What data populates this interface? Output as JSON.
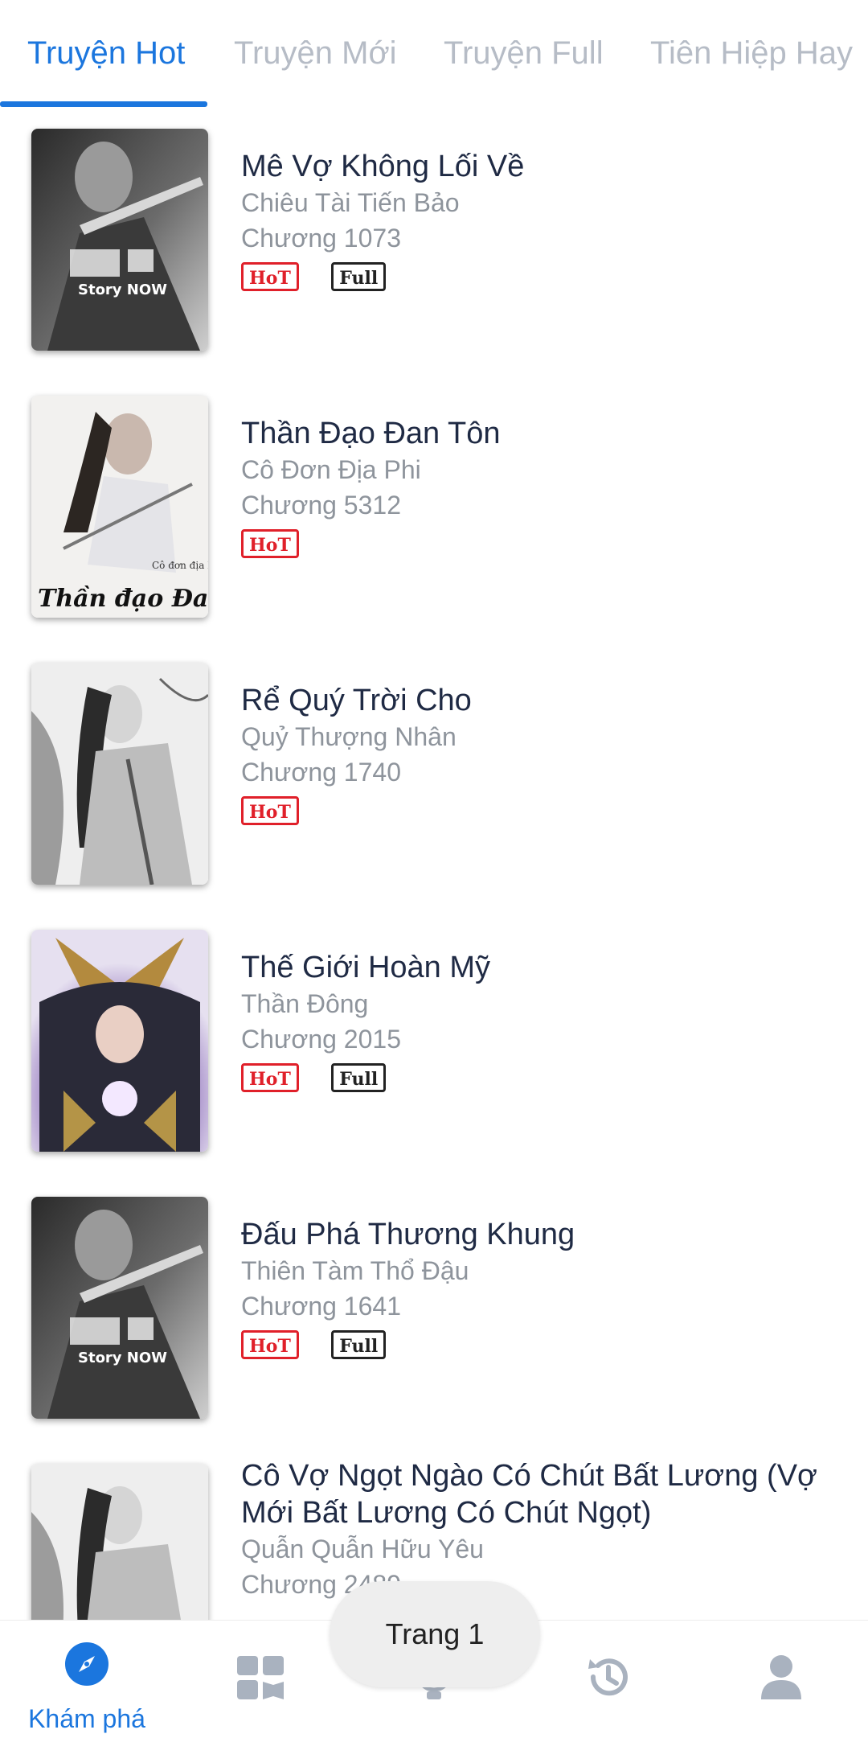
{
  "tabs": [
    {
      "label": "Truyện Hot",
      "active": true
    },
    {
      "label": "Truyện Mới",
      "active": false
    },
    {
      "label": "Truyện Full",
      "active": false
    },
    {
      "label": "Tiên Hiệp Hay",
      "active": false
    }
  ],
  "stories": [
    {
      "title": "Mê Vợ Không Lối Về",
      "author": "Chiêu Tài Tiến Bảo",
      "chapter": "Chương 1073",
      "hot": "HoT",
      "full": "Full",
      "cover_text": "Story NOW"
    },
    {
      "title": "Thần Đạo Đan Tôn",
      "author": "Cô Đơn Địa Phi",
      "chapter": "Chương 5312",
      "hot": "HoT",
      "cover_text": "Thần đạo Đan tôn",
      "cover_author": "Cô đơn địa Phi"
    },
    {
      "title": "Rể Quý Trời Cho",
      "author": "Quỷ Thượng Nhân",
      "chapter": "Chương 1740",
      "hot": "HoT"
    },
    {
      "title": "Thế Giới Hoàn Mỹ",
      "author": "Thần Đông",
      "chapter": "Chương 2015",
      "hot": "HoT",
      "full": "Full"
    },
    {
      "title": "Đấu Phá Thương Khung",
      "author": "Thiên Tàm Thổ Đậu",
      "chapter": "Chương 1641",
      "hot": "HoT",
      "full": "Full",
      "cover_text": "Story NOW"
    },
    {
      "title": "Cô Vợ Ngọt Ngào Có Chút Bất Lương (Vợ Mới Bất Lương Có Chút Ngọt)",
      "author": "Quẫn Quẫn Hữu Yêu",
      "chapter": "Chương 2489"
    }
  ],
  "toast": {
    "text": "Trang 1"
  },
  "bottom_nav": {
    "items": [
      {
        "icon": "compass-icon",
        "label": "Khám phá",
        "active": true
      },
      {
        "icon": "library-icon"
      },
      {
        "icon": "lightbulb-icon"
      },
      {
        "icon": "history-icon"
      },
      {
        "icon": "user-icon"
      }
    ]
  },
  "colors": {
    "accent": "#1b76de",
    "hot": "#e0202a",
    "title": "#1f2a44",
    "muted": "#8e949c",
    "inactive_tab": "#b6bcc6"
  }
}
